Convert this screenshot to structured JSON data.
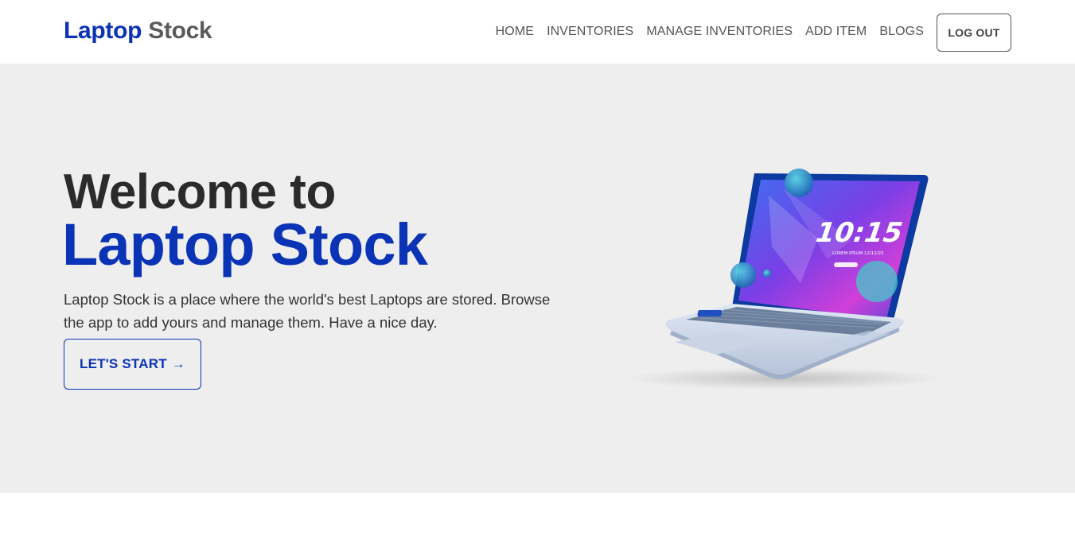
{
  "brand": {
    "part1": "Laptop",
    "part2": "Stock"
  },
  "nav": {
    "items": [
      {
        "label": "HOME"
      },
      {
        "label": "INVENTORIES"
      },
      {
        "label": "MANAGE INVENTORIES"
      },
      {
        "label": "ADD ITEM"
      },
      {
        "label": "BLOGS"
      }
    ],
    "logout_label": "LOG OUT"
  },
  "hero": {
    "title_line1": "Welcome to",
    "title_line2": "Laptop Stock",
    "description": "Laptop Stock is a place where the world's best Laptops are stored. Browse the app to add yours and manage them. Have a nice day.",
    "cta_label": "LET'S START",
    "cta_arrow": "→",
    "laptop_image": {
      "clock": "10:15",
      "subtext": "LOREM IPSUM 12/12/22"
    }
  },
  "colors": {
    "brand_blue": "#0a33b6",
    "hero_bg": "#eeeeee",
    "nav_text": "#555555"
  }
}
